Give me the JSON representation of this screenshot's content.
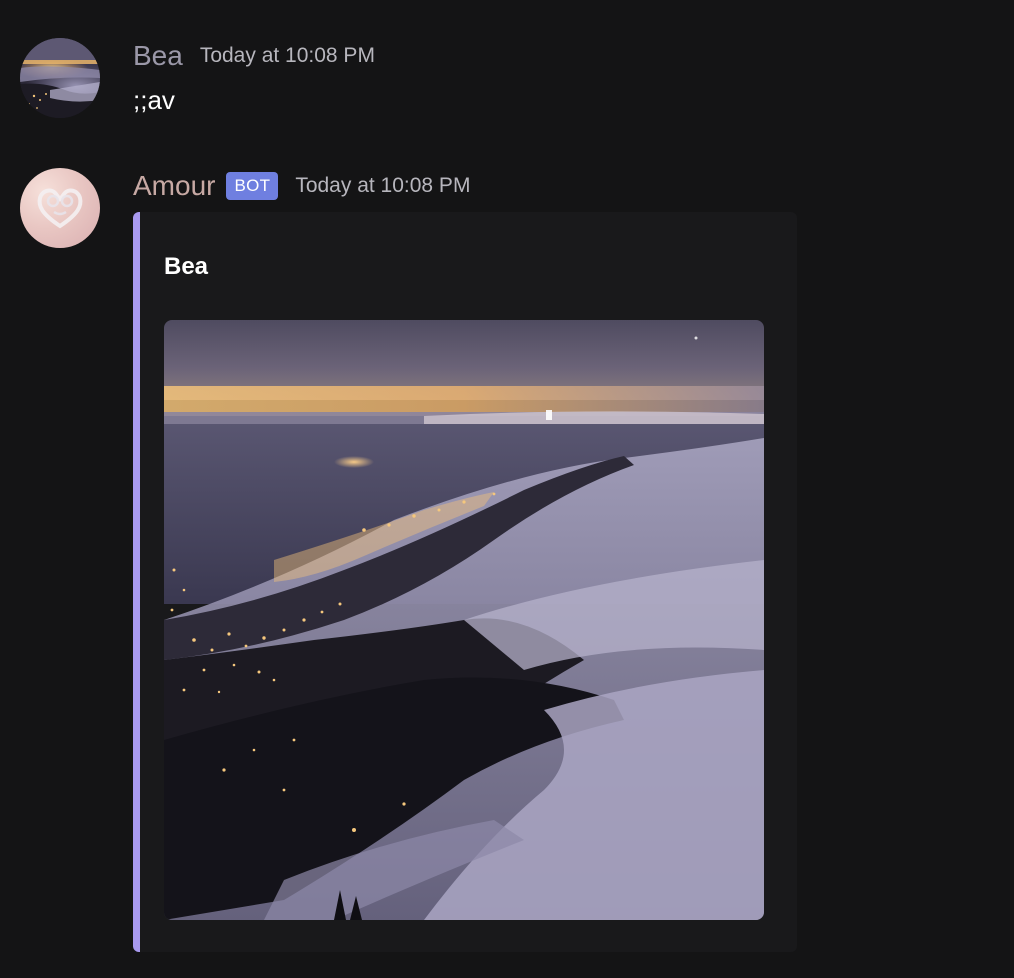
{
  "messages": [
    {
      "author": "Bea",
      "timestamp": "Today at 10:08 PM",
      "content": ";;av",
      "avatar_icon": "user-avatar-night-city-fog",
      "name_color": "#9b98a8"
    },
    {
      "author": "Amour",
      "bot_tag": "BOT",
      "timestamp": "Today at 10:08 PM",
      "avatar_icon": "bot-avatar-heart",
      "name_color": "#c7a9a4",
      "embed": {
        "title": "Bea",
        "accent_color": "#a99af0",
        "image_icon": "avatar-image-night-city-fog"
      }
    }
  ],
  "colors": {
    "background": "#141415",
    "embed_background": "#19191b",
    "bot_tag": "#6f7fe0",
    "text": "#ffffff",
    "timestamp": "#b7b6bd"
  }
}
